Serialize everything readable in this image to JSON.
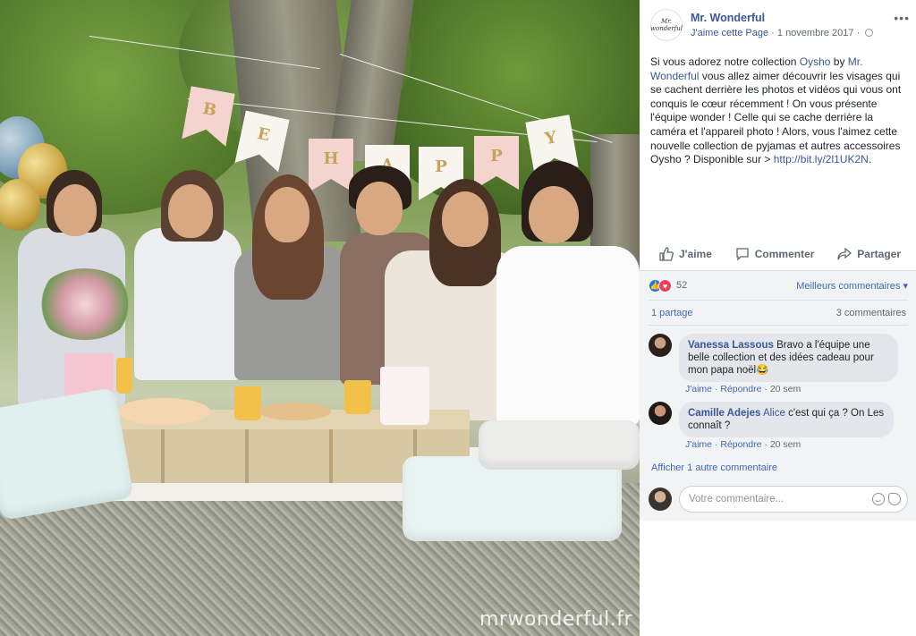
{
  "photo": {
    "watermark": "mrwonderful.fr",
    "banner_letters": [
      "B",
      "E",
      "H",
      "A",
      "P",
      "P",
      "Y"
    ]
  },
  "post": {
    "page_name": "Mr. Wonderful",
    "like_page": "J'aime cette Page",
    "separator": "·",
    "date": "1 novembre 2017",
    "text_before_oysho": "Si vous adorez notre collection ",
    "oysho_link": "Oysho",
    "text_by": " by ",
    "mr_link": "Mr. Wonderful",
    "text_body": " vous allez aimer découvrir les visages qui se cachent derrière les photos et vidéos qui vous ont conquis le cœur récemment ! On vous présente l'équipe wonder ! Celle qui se cache derrière la caméra et l'appareil photo ! Alors, vous l'aimez cette nouvelle collection de pyjamas et autres accessoires Oysho ? Disponible sur > ",
    "url": "http://bit.ly/2l1UK2N",
    "url_tail": "."
  },
  "actions": {
    "like": "J'aime",
    "comment": "Commenter",
    "share": "Partager"
  },
  "reactions": {
    "count": "52",
    "sort_label": "Meilleurs commentaires",
    "shares": "1 partage",
    "comments": "3 commentaires"
  },
  "comments": [
    {
      "author": "Vanessa Lassous",
      "text": " Bravo a l'équipe une belle collection et des idées cadeau pour mon papa noël",
      "emoji": "😂",
      "like": "J'aime",
      "reply": "Répondre",
      "time": "20 sem"
    },
    {
      "author": "Camille Adejes",
      "tag": "Alice",
      "text": " c'est qui ça ? On Les connaît ?",
      "like": "J'aime",
      "reply": "Répondre",
      "time": "20 sem"
    }
  ],
  "more_comments": "Afficher 1 autre commentaire",
  "reply_placeholder": "Votre commentaire...",
  "colors": {
    "link": "#385898",
    "like_blue": "#1877f2",
    "love_red": "#f33e58",
    "comment_bg": "#f2f3f5"
  }
}
